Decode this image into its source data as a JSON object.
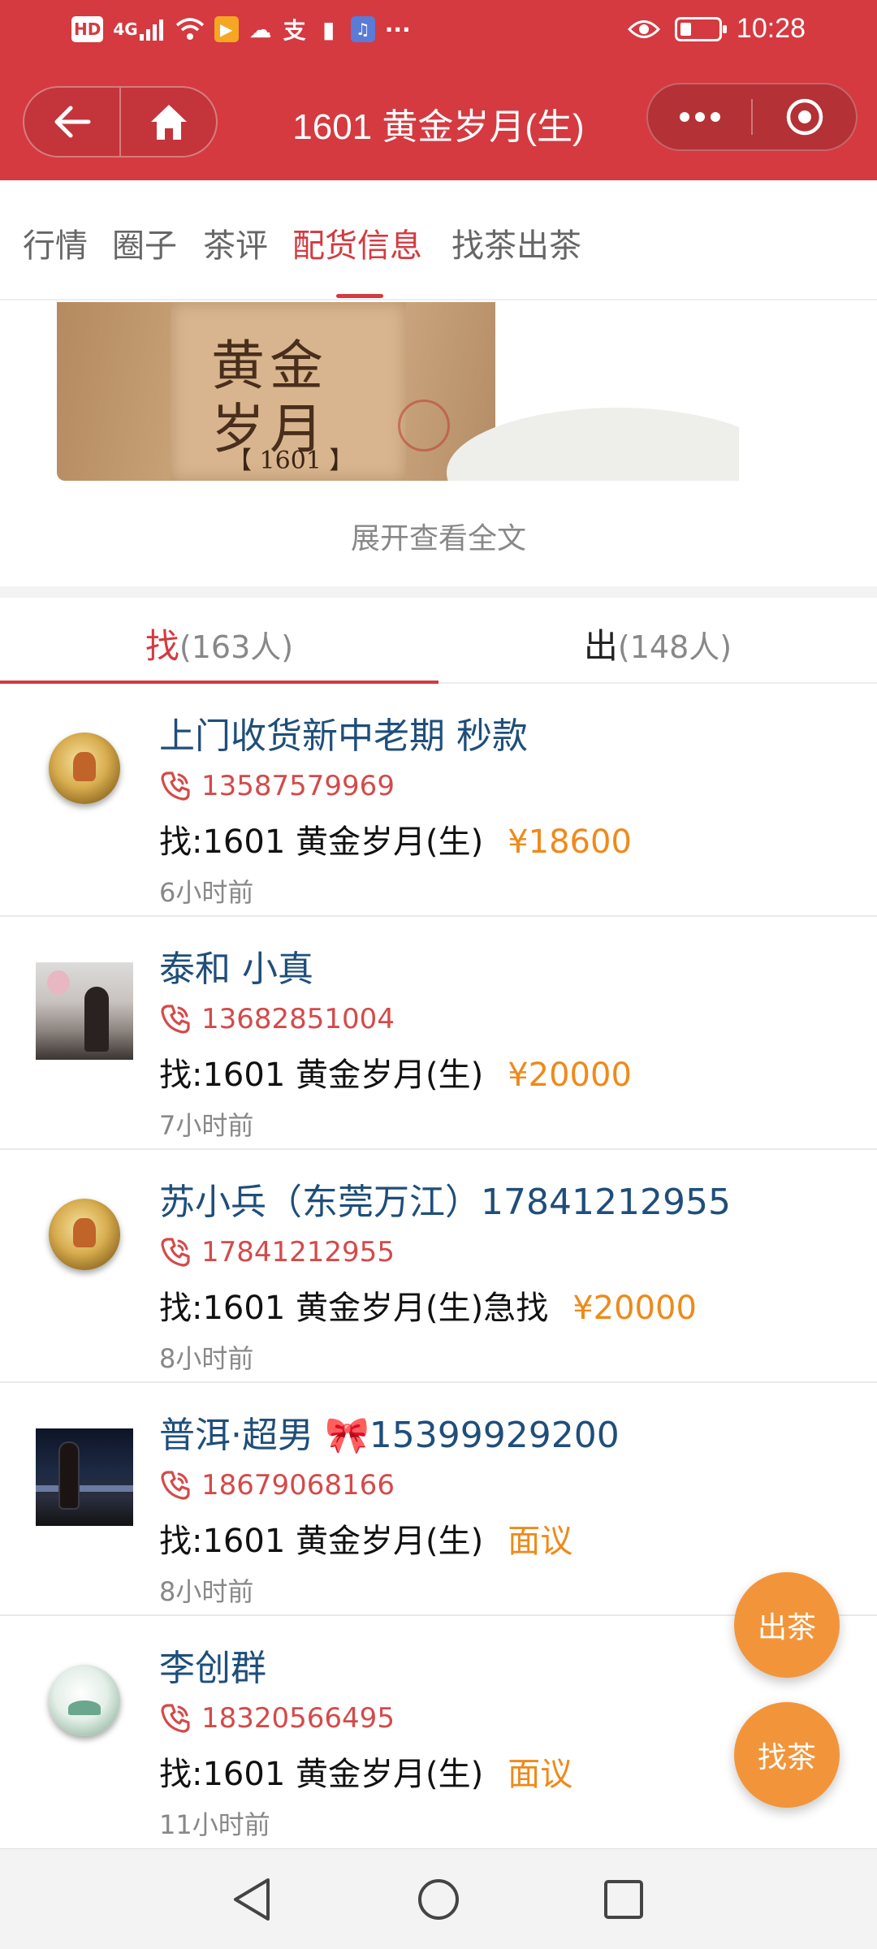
{
  "status_bar": {
    "hd": "HD",
    "network": "4G",
    "more": "···",
    "time": "10:28",
    "battery_level": 0.3
  },
  "header": {
    "title": "1601 黄金岁月(生)",
    "back_icon": "arrow-left-icon",
    "home_icon": "home-icon",
    "more_icon": "more-dots-icon",
    "close_icon": "target-circle-icon",
    "color": "#d43a40"
  },
  "category_tabs": [
    {
      "label": "行情"
    },
    {
      "label": "圈子"
    },
    {
      "label": "茶评"
    },
    {
      "label": "配货信息",
      "active": true
    },
    {
      "label": "找茶出茶"
    }
  ],
  "article": {
    "image_text": "黄金岁月",
    "image_year": "【 1601 】",
    "expand_label": "展开查看全文"
  },
  "find_sell_tabs": {
    "find_label": "找",
    "find_count": "(163人)",
    "sell_label": "出",
    "sell_count": "(148人)",
    "active": "find"
  },
  "listings": [
    {
      "name": "上门收货新中老期 秒款",
      "phone": "13587579969",
      "want": "找:1601 黄金岁月(生)",
      "price": "¥18600",
      "time": "6小时前",
      "avatar": "gold-coin"
    },
    {
      "name": "泰和 小真",
      "phone": "13682851004",
      "want": "找:1601 黄金岁月(生)",
      "price": "¥20000",
      "time": "7小时前",
      "avatar": "photo"
    },
    {
      "name": "苏小兵（东莞万江）17841212955",
      "phone": "17841212955",
      "want": "找:1601 黄金岁月(生)急找",
      "price": "¥20000",
      "time": "8小时前",
      "avatar": "gold-coin"
    },
    {
      "name": "普洱·超男 🎀15399929200",
      "phone": "18679068166",
      "want": "找:1601 黄金岁月(生)",
      "price": "面议",
      "time": "8小时前",
      "avatar": "night-photo"
    },
    {
      "name": "李创群",
      "phone": "18320566495",
      "want": "找:1601 黄金岁月(生)",
      "price": "面议",
      "time": "11小时前",
      "avatar": "jade-coin"
    }
  ],
  "fab": {
    "sell_label": "出茶",
    "find_label": "找茶",
    "color": "#f2953a"
  },
  "colors": {
    "accent": "#d43a40",
    "price": "#ee8a1a",
    "name": "#1f4e7a",
    "phone": "#d44a4a"
  }
}
